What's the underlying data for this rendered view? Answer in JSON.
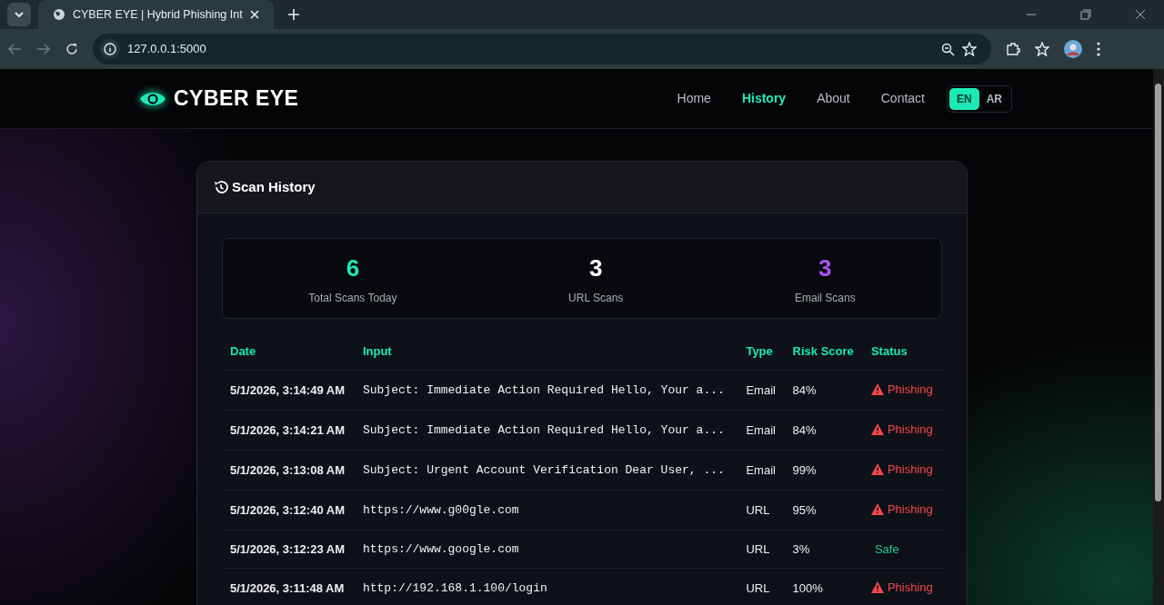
{
  "browser": {
    "tab_title": "CYBER EYE | Hybrid Phishing Int",
    "url": "127.0.0.1:5000"
  },
  "navbar": {
    "brand": "CYBER EYE",
    "links": [
      {
        "label": "Home",
        "selected": false
      },
      {
        "label": "History",
        "selected": true
      },
      {
        "label": "About",
        "selected": false
      },
      {
        "label": "Contact",
        "selected": false
      }
    ],
    "languages": [
      {
        "label": "EN",
        "selected": true
      },
      {
        "label": "AR",
        "selected": false
      }
    ]
  },
  "card": {
    "title": "Scan History",
    "stats": [
      {
        "value": "6",
        "label": "Total Scans Today",
        "color": "#1de9b6"
      },
      {
        "value": "3",
        "label": "URL Scans",
        "color": "#ffffff"
      },
      {
        "value": "3",
        "label": "Email Scans",
        "color": "#a855f7"
      }
    ],
    "table": {
      "columns": [
        "Date",
        "Input",
        "Type",
        "Risk Score",
        "Status"
      ],
      "rows": [
        {
          "date": "5/1/2026, 3:14:49 AM",
          "input": "Subject: Immediate Action Required Hello, Your a...",
          "type": "Email",
          "risk": "84%",
          "status": {
            "label": "Phishing",
            "kind": "phishing"
          }
        },
        {
          "date": "5/1/2026, 3:14:21 AM",
          "input": "Subject: Immediate Action Required Hello, Your a...",
          "type": "Email",
          "risk": "84%",
          "status": {
            "label": "Phishing",
            "kind": "phishing"
          }
        },
        {
          "date": "5/1/2026, 3:13:08 AM",
          "input": "Subject: Urgent Account Verification Dear User, ...",
          "type": "Email",
          "risk": "99%",
          "status": {
            "label": "Phishing",
            "kind": "phishing"
          }
        },
        {
          "date": "5/1/2026, 3:12:40 AM",
          "input": "https://www.g00gle.com",
          "type": "URL",
          "risk": "95%",
          "status": {
            "label": "Phishing",
            "kind": "phishing"
          }
        },
        {
          "date": "5/1/2026, 3:12:23 AM",
          "input": "https://www.google.com",
          "type": "URL",
          "risk": "3%",
          "status": {
            "label": "Safe",
            "kind": "safe"
          }
        },
        {
          "date": "5/1/2026, 3:11:48 AM",
          "input": "http://192.168.1.100/login",
          "type": "URL",
          "risk": "100%",
          "status": {
            "label": "Phishing",
            "kind": "phishing"
          }
        }
      ]
    }
  }
}
